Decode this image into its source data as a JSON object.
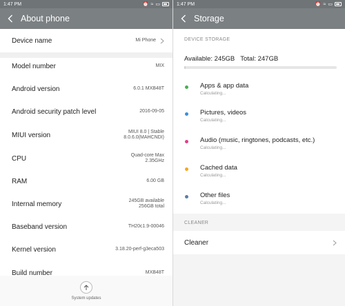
{
  "left": {
    "status": {
      "time": "1:47 PM"
    },
    "title": "About phone",
    "rows": [
      {
        "label": "Device name",
        "value": "Mi Phone"
      },
      {
        "label": "Model number",
        "value": "MIX"
      },
      {
        "label": "Android version",
        "value": "6.0.1 MXB48T"
      },
      {
        "label": "Android security patch level",
        "value": "2016-09-05"
      },
      {
        "label": "MIUI version",
        "value": "MIUI 8.0 | Stable\n8.0.6.0(MAHCNDI)"
      },
      {
        "label": "CPU",
        "value": "Quad-core Max\n2.35GHz"
      },
      {
        "label": "RAM",
        "value": "6.00 GB"
      },
      {
        "label": "Internal memory",
        "value": "245GB available\n256GB total"
      },
      {
        "label": "Baseband version",
        "value": "TH20c1.9-00046"
      },
      {
        "label": "Kernel version",
        "value": "3.18.20-perf-g3eca503"
      },
      {
        "label": "Build number",
        "value": "MXB48T"
      }
    ],
    "system_updates": "System updates"
  },
  "right": {
    "status": {
      "time": "1:47 PM"
    },
    "title": "Storage",
    "device_storage_header": "DEVICE STORAGE",
    "available": "Available: 245GB",
    "total": "Total: 247GB",
    "usage_fraction": 0.01,
    "categories": [
      {
        "name": "Apps & app data",
        "status": "Calculating...",
        "color": "#4caf50"
      },
      {
        "name": "Pictures, videos",
        "status": "Calculating...",
        "color": "#3b8fd9"
      },
      {
        "name": "Audio (music, ringtones, podcasts, etc.)",
        "status": "Calculating...",
        "color": "#e0418a"
      },
      {
        "name": "Cached data",
        "status": "Calculating...",
        "color": "#f5a623"
      },
      {
        "name": "Other files",
        "status": "Calculating...",
        "color": "#5b7fa6"
      }
    ],
    "cleaner_header": "CLEANER",
    "cleaner_label": "Cleaner"
  }
}
